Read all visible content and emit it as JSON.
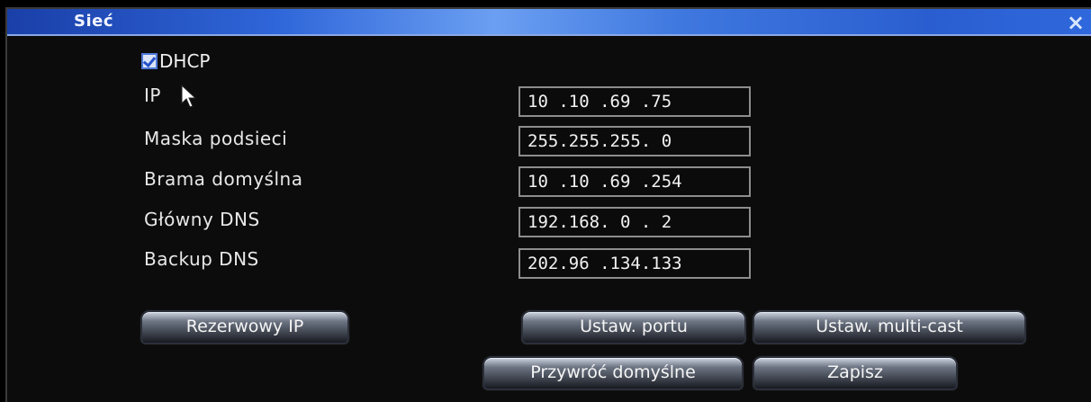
{
  "window": {
    "title": "Sieć",
    "close_label": "×"
  },
  "dhcp": {
    "label": "DHCP",
    "checked": true
  },
  "fields": {
    "ip": {
      "label": "IP",
      "value": "10 .10 .69 .75"
    },
    "mask": {
      "label": "Maska podsieci",
      "value": "255.255.255. 0"
    },
    "gateway": {
      "label": "Brama domyślna",
      "value": "10 .10 .69 .254"
    },
    "primary_dns": {
      "label": "Główny DNS",
      "value": "192.168. 0 . 2"
    },
    "backup_dns": {
      "label": "Backup DNS",
      "value": "202.96 .134.133"
    }
  },
  "buttons": {
    "backup_ip": "Rezerwowy IP",
    "port_settings": "Ustaw. portu",
    "multicast_settings": "Ustaw. multi-cast",
    "restore_defaults": "Przywróć domyślne",
    "save": "Zapisz"
  },
  "colors": {
    "title_bar": "#2f66d9",
    "background": "#0c0c0c",
    "field_border": "#8d8d8d",
    "checkbox_accent": "#2451c9"
  },
  "icons": {
    "close": "close-icon",
    "checkbox": "checkmark-icon",
    "pointer": "mouse-pointer-icon"
  }
}
